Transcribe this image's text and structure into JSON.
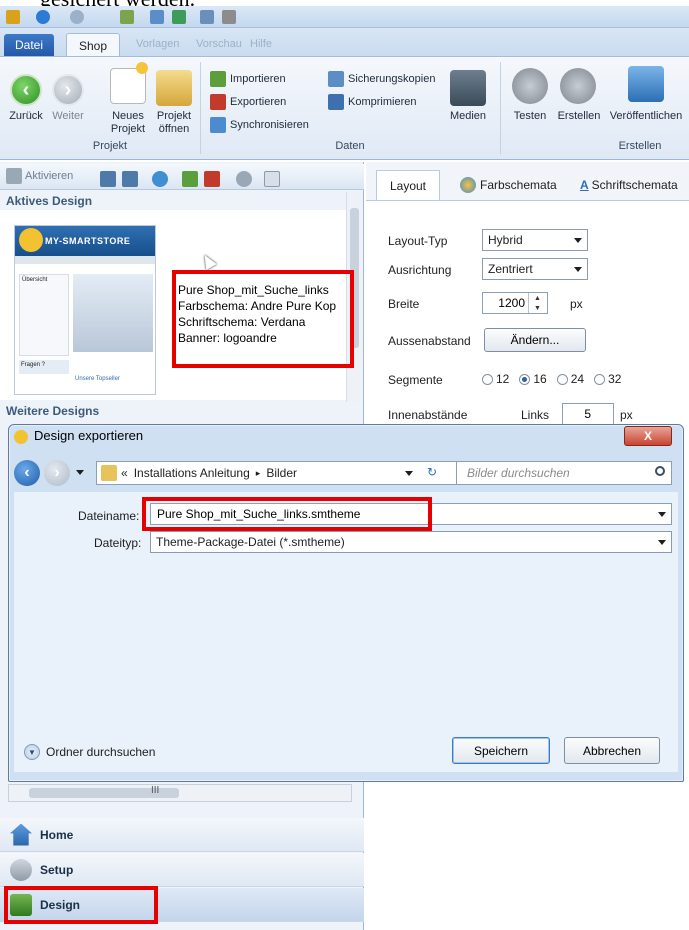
{
  "caption_fragment": "gesichert werden.",
  "ribbon": {
    "tabs": {
      "file": "Datei",
      "shop": "Shop",
      "ghost1": "Vorlagen",
      "ghost2": "Vorschau",
      "ghost3": "Hilfe"
    },
    "projekt": {
      "back": "Zurück",
      "forward": "Weiter",
      "new_project": "Neues\nProjekt",
      "open_project": "Projekt\nöffnen",
      "group": "Projekt"
    },
    "daten": {
      "import": "Importieren",
      "export": "Exportieren",
      "sync": "Synchronisieren",
      "backups": "Sicherungskopien",
      "compress": "Komprimieren",
      "media": "Medien",
      "group": "Daten"
    },
    "erstellen": {
      "test": "Testen",
      "build": "Erstellen",
      "publish": "Veröffentlichen",
      "group": "Erstellen"
    }
  },
  "left": {
    "toolbar_activate": "Aktivieren",
    "active_design_head": "Aktives Design",
    "more_designs_head": "Weitere Designs",
    "thumb_logo": "MY-SMARTSTORE",
    "thumb_sidebar_title": "Übersicht",
    "thumb_faq": "Fragen ?",
    "thumb_top": "Unsere Topseller",
    "info": {
      "name": "Pure Shop_mit_Suche_links",
      "color": "Farbschema: Andre Pure Kop",
      "font": "Schriftschema: Verdana",
      "banner": "Banner: logoandre"
    }
  },
  "right": {
    "tabs": {
      "layout": "Layout",
      "colors": "Farbschemata",
      "fonts": "Schriftschemata"
    },
    "layout_type_label": "Layout-Typ",
    "layout_type_value": "Hybrid",
    "alignment_label": "Ausrichtung",
    "alignment_value": "Zentriert",
    "width_label": "Breite",
    "width_value": "1200",
    "width_unit": "px",
    "margin_label": "Aussenabstand",
    "margin_button": "Ändern...",
    "segments_label": "Segmente",
    "segments": [
      "12",
      "16",
      "24",
      "32"
    ],
    "segments_selected": "16",
    "padding_label": "Innenabstände",
    "padding_side": "Links",
    "padding_value": "5",
    "padding_unit": "px"
  },
  "dialog": {
    "title": "Design exportieren",
    "close": "X",
    "path_prefix": "«",
    "path_part1": "Installations Anleitung",
    "path_sep": "▸",
    "path_part2": "Bilder",
    "search_placeholder": "Bilder durchsuchen",
    "filename_label": "Dateiname:",
    "filename_value": "Pure Shop_mit_Suche_links.smtheme",
    "filetype_label": "Dateityp:",
    "filetype_value": "Theme-Package-Datei (*.smtheme)",
    "browse_folders": "Ordner durchsuchen",
    "save": "Speichern",
    "cancel": "Abbrechen"
  },
  "nav": {
    "home": "Home",
    "setup": "Setup",
    "design": "Design"
  },
  "colors": {
    "highlight": "#e60000",
    "ribbon_blue": "#2459a8"
  }
}
